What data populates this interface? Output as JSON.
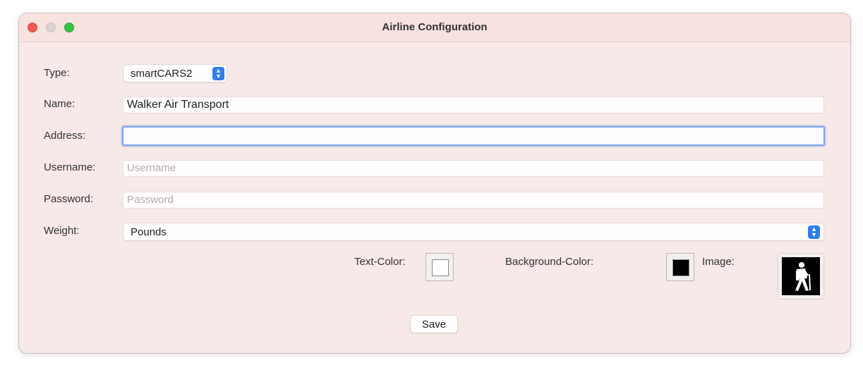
{
  "window": {
    "title": "Airline Configuration"
  },
  "form": {
    "type": {
      "label": "Type:",
      "value": "smartCARS2"
    },
    "name": {
      "label": "Name:",
      "value": "Walker Air Transport"
    },
    "address": {
      "label": "Address:",
      "value": ""
    },
    "username": {
      "label": "Username:",
      "value": "",
      "placeholder": "Username"
    },
    "password": {
      "label": "Password:",
      "value": "",
      "placeholder": "Password"
    },
    "weight": {
      "label": "Weight:",
      "value": "Pounds"
    }
  },
  "colors": {
    "text_color": {
      "label": "Text-Color:",
      "value": "#ffffff"
    },
    "background_color": {
      "label": "Background-Color:",
      "value": "#000000"
    },
    "image": {
      "label": "Image:",
      "icon": "hiker-icon"
    }
  },
  "actions": {
    "save_label": "Save"
  }
}
